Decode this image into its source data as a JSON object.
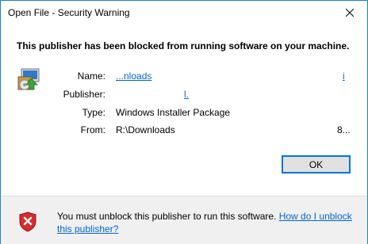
{
  "window": {
    "title": "Open File - Security Warning"
  },
  "headline": "This publisher has been blocked from running software on your machine.",
  "fields": {
    "name_label": "Name:",
    "name_value": "...nloads",
    "name_trailing": "i",
    "publisher_label": "Publisher:",
    "publisher_trailing": "l.",
    "type_label": "Type:",
    "type_value": "Windows Installer Package",
    "from_label": "From:",
    "from_value": "R:\\Downloads\\",
    "from_trailing": "8..."
  },
  "buttons": {
    "ok": "OK"
  },
  "footer": {
    "message": "You must unblock this publisher to run this software.",
    "link": "How do I unblock this publisher?"
  },
  "icons": {
    "close": "close-icon",
    "package": "installer-package-icon",
    "shield": "shield-error-icon"
  },
  "colors": {
    "accent": "#0078d7",
    "link": "#0066cc",
    "shield": "#d92b2b"
  }
}
